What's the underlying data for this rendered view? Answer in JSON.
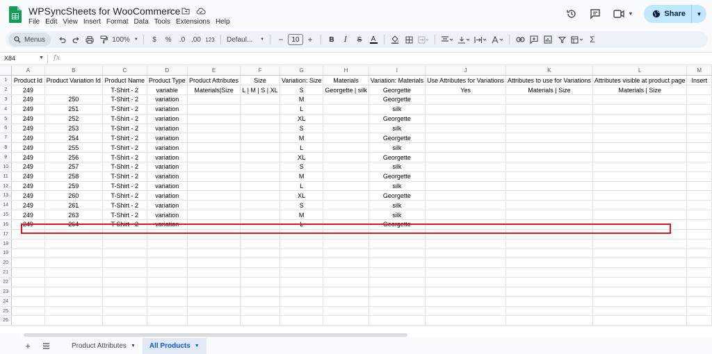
{
  "app": {
    "doc_title": "WPSyncSheets for WooCommerce",
    "menu": [
      "File",
      "Edit",
      "View",
      "Insert",
      "Format",
      "Data",
      "Tools",
      "Extensions",
      "Help"
    ],
    "share_label": "Share",
    "brand_color": "#0f9d58",
    "share_bg": "#c2e7ff"
  },
  "toolbar": {
    "menus_label": "Menus",
    "zoom": "100%",
    "currency": "$",
    "percent": "%",
    "decrease_decimal": ".0",
    "increase_decimal": ".00",
    "number_format": "123",
    "font_name": "Defaul...",
    "font_size": "10",
    "minus": "−",
    "plus": "+",
    "bold": "B",
    "italic": "I",
    "strike": "S",
    "text_color": "A"
  },
  "formula_bar": {
    "cell_ref": "X84",
    "fx": "fx"
  },
  "grid": {
    "columns": [
      "A",
      "B",
      "C",
      "D",
      "E",
      "F",
      "G",
      "H",
      "I",
      "J",
      "K",
      "L",
      "M"
    ],
    "rows": [
      [
        "Product Id",
        "Product Variation Id",
        "Product Name",
        "Product Type",
        "Product Attributes",
        "Size",
        "Variation: Size",
        "Materials",
        "Variation: Materials",
        "Use Attributes for Variations",
        "Attributes to use for Variations",
        "Attributes visible at product page",
        "Insert"
      ],
      [
        "249",
        "",
        "T-Shirt - 2",
        "variable",
        "Materials|Size",
        "L | M | S | XL",
        "S",
        "Georgette | silk",
        "Georgette",
        "Yes",
        "Materials | Size",
        "Materials | Size",
        ""
      ],
      [
        "249",
        "250",
        "T-Shirt - 2",
        "variation",
        "",
        "",
        "M",
        "",
        "Georgette",
        "",
        "",
        "",
        ""
      ],
      [
        "249",
        "251",
        "T-Shirt - 2",
        "variation",
        "",
        "",
        "L",
        "",
        "silk",
        "",
        "",
        "",
        ""
      ],
      [
        "249",
        "252",
        "T-Shirt - 2",
        "variation",
        "",
        "",
        "XL",
        "",
        "Georgette",
        "",
        "",
        "",
        ""
      ],
      [
        "249",
        "253",
        "T-Shirt - 2",
        "variation",
        "",
        "",
        "S",
        "",
        "silk",
        "",
        "",
        "",
        ""
      ],
      [
        "249",
        "254",
        "T-Shirt - 2",
        "variation",
        "",
        "",
        "M",
        "",
        "Georgette",
        "",
        "",
        "",
        ""
      ],
      [
        "249",
        "255",
        "T-Shirt - 2",
        "variation",
        "",
        "",
        "L",
        "",
        "silk",
        "",
        "",
        "",
        ""
      ],
      [
        "249",
        "256",
        "T-Shirt - 2",
        "variation",
        "",
        "",
        "XL",
        "",
        "Georgette",
        "",
        "",
        "",
        ""
      ],
      [
        "249",
        "257",
        "T-Shirt - 2",
        "variation",
        "",
        "",
        "S",
        "",
        "silk",
        "",
        "",
        "",
        ""
      ],
      [
        "249",
        "258",
        "T-Shirt - 2",
        "variation",
        "",
        "",
        "M",
        "",
        "Georgette",
        "",
        "",
        "",
        ""
      ],
      [
        "249",
        "259",
        "T-Shirt - 2",
        "variation",
        "",
        "",
        "L",
        "",
        "silk",
        "",
        "",
        "",
        ""
      ],
      [
        "249",
        "260",
        "T-Shirt - 2",
        "variation",
        "",
        "",
        "XL",
        "",
        "Georgette",
        "",
        "",
        "",
        ""
      ],
      [
        "249",
        "261",
        "T-Shirt - 2",
        "variation",
        "",
        "",
        "S",
        "",
        "silk",
        "",
        "",
        "",
        ""
      ],
      [
        "249",
        "263",
        "T-Shirt - 2",
        "variation",
        "",
        "",
        "M",
        "",
        "silk",
        "",
        "",
        "",
        ""
      ],
      [
        "249",
        "264",
        "T-Shirt - 2",
        "variation",
        "",
        "",
        "L",
        "",
        "Georgette",
        "",
        "",
        "",
        ""
      ]
    ],
    "total_rows": 26,
    "highlight_color": "#e0141e"
  },
  "sheets": {
    "tabs": [
      {
        "label": "Product Attributes",
        "active": false
      },
      {
        "label": "All Products",
        "active": true
      }
    ]
  }
}
